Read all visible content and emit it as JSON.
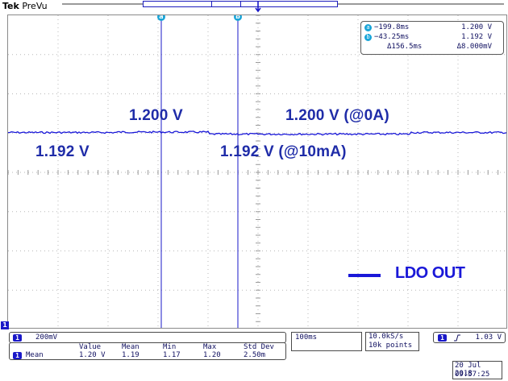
{
  "brand": {
    "maker": "Tek",
    "mode": "PreVu"
  },
  "cursors": {
    "a_label": "a",
    "b_label": "b"
  },
  "cursor_readout": {
    "a": {
      "label": "a",
      "time": "−199.8ms",
      "value": "1.200 V"
    },
    "b": {
      "label": "b",
      "time": "−43.25ms",
      "value": "1.192 V"
    },
    "delta": {
      "time": "Δ156.5ms",
      "value": "Δ8.000mV"
    }
  },
  "annotations": {
    "left_high": "1.200 V",
    "left_low": "1.192 V",
    "right_high": "1.200 V (@0A)",
    "right_low": "1.192 V (@10mA)"
  },
  "legend": {
    "label": "LDO OUT",
    "color": "#1a18d8"
  },
  "channel": {
    "number": "1",
    "scale": "200mV"
  },
  "measurement": {
    "headers": [
      "Value",
      "Mean",
      "Min",
      "Max",
      "Std Dev"
    ],
    "row_label": "Mean",
    "values": [
      "1.20 V",
      "1.19",
      "1.17",
      "1.20",
      "2.50m"
    ]
  },
  "timebase": {
    "per_div": "100ms"
  },
  "acquisition": {
    "sample_rate": "10.0kS/s",
    "record_length": "10k points"
  },
  "trigger": {
    "source": "1",
    "slope_icon": "rising-edge-icon",
    "level": "1.03 V"
  },
  "datetime": {
    "date": "20 Jul  2018",
    "time": "09:57:25"
  },
  "colors": {
    "trace": "#1a18d8",
    "cursor": "#1a18c8",
    "annotation": "#1f2ca8",
    "badge": "#1aa5d8"
  }
}
